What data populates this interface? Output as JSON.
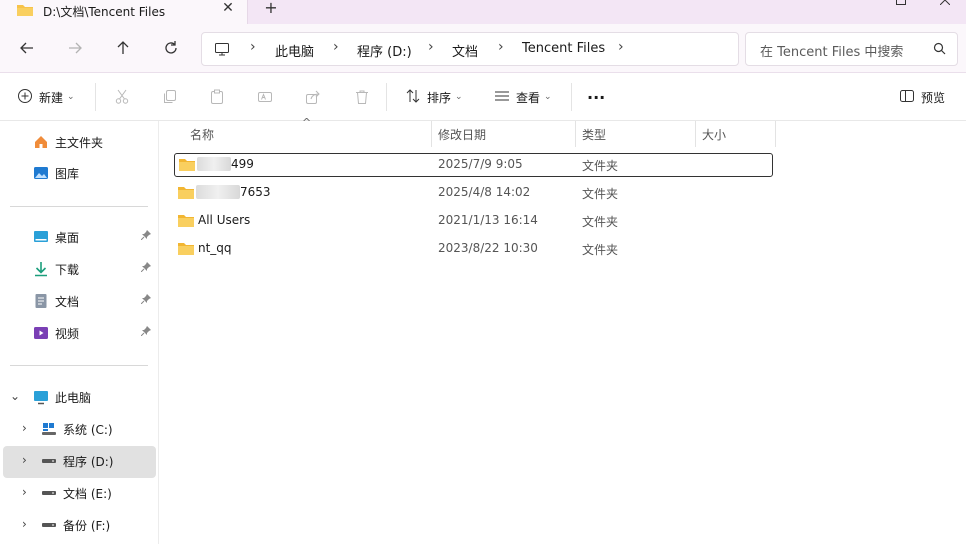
{
  "window": {
    "tab_title": "D:\\文档\\Tencent Files",
    "new_tab": "+",
    "close": "✕"
  },
  "nav": {
    "breadcrumb": [
      "此电脑",
      "程序 (D:)",
      "文档",
      "Tencent Files"
    ],
    "search_placeholder": "在 Tencent Files 中搜索"
  },
  "toolbar": {
    "new": "新建",
    "sort": "排序",
    "view": "查看",
    "more": "···",
    "preview": "预览"
  },
  "sidebar": {
    "home": "主文件夹",
    "gallery": "图库",
    "quick": [
      "桌面",
      "下载",
      "文档",
      "视频"
    ],
    "this_pc": "此电脑",
    "drives": [
      "系统 (C:)",
      "程序 (D:)",
      "文档 (E:)",
      "备份 (F:)"
    ]
  },
  "columns": {
    "name": "名称",
    "modified": "修改日期",
    "type": "类型",
    "size": "大小"
  },
  "files": [
    {
      "name": "499",
      "modified": "2025/7/9 9:05",
      "type": "文件夹"
    },
    {
      "name": "7653",
      "modified": "2025/4/8 14:02",
      "type": "文件夹"
    },
    {
      "name": "All Users",
      "modified": "2021/1/13 16:14",
      "type": "文件夹"
    },
    {
      "name": "nt_qq",
      "modified": "2023/8/22 10:30",
      "type": "文件夹"
    }
  ],
  "colors": {
    "accent": "#0067c0",
    "folder": "#f7c34a",
    "titlebar": "#f3e6f5",
    "selected": "#e1e1e1"
  }
}
